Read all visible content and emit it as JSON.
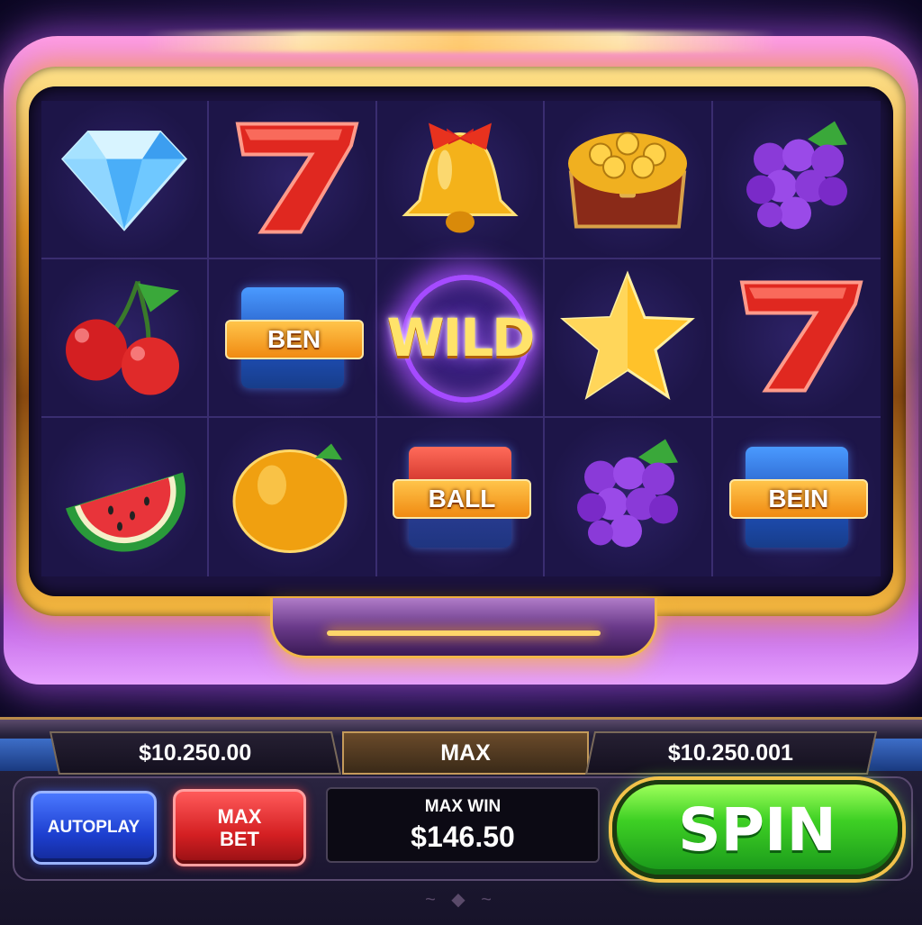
{
  "reels": [
    [
      "diamond",
      "seven",
      "bell",
      "treasure-chest",
      "grapes"
    ],
    [
      "cherries",
      "sign-blue",
      "wild",
      "star",
      "seven"
    ],
    [
      "watermelon",
      "orange",
      "sign-red",
      "grapes",
      "sign-blue"
    ]
  ],
  "symbol_labels": {
    "sign_r2c2": "BEN",
    "wild": "WILD",
    "sign_r3c3": "BALL",
    "sign_r3c5": "BEIN"
  },
  "panel": {
    "balance_left": "$10.250.00",
    "center_label": "MAX",
    "balance_right": "$10.250.001",
    "autoplay_label": "AUTOPLAY",
    "max_bet_line1": "MAX",
    "max_bet_line2": "BET",
    "max_win_label": "MAX WIN",
    "max_win_value": "$146.50",
    "spin_label": "SPIN"
  },
  "colors": {
    "frame_purple": "#b04ad8",
    "frame_gold": "#d68a1e",
    "spin_green": "#3ed024",
    "autoplay_blue": "#1d3fd0",
    "maxbet_red": "#d41f22"
  }
}
